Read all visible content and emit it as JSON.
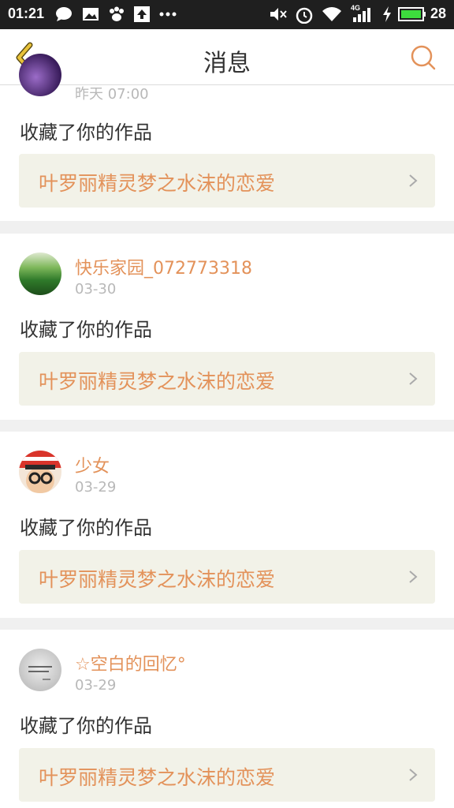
{
  "status_bar": {
    "time": "01:21",
    "network": "4G",
    "battery": "28"
  },
  "header": {
    "title": "消息"
  },
  "colors": {
    "accent": "#e3925a",
    "back_arrow": "#e8c23a",
    "card_bg": "#f2f2e8"
  },
  "messages": [
    {
      "date": "昨天 07:00",
      "action": "收藏了你的作品",
      "work_title": "叶罗丽精灵梦之水沫的恋爱"
    },
    {
      "user": "快乐家园_072773318",
      "date": "03-30",
      "action": "收藏了你的作品",
      "work_title": "叶罗丽精灵梦之水沫的恋爱"
    },
    {
      "user": "少女",
      "date": "03-29",
      "action": "收藏了你的作品",
      "work_title": "叶罗丽精灵梦之水沫的恋爱"
    },
    {
      "user": "☆空白的回忆°",
      "date": "03-29",
      "action": "收藏了你的作品",
      "work_title": "叶罗丽精灵梦之水沫的恋爱"
    }
  ]
}
